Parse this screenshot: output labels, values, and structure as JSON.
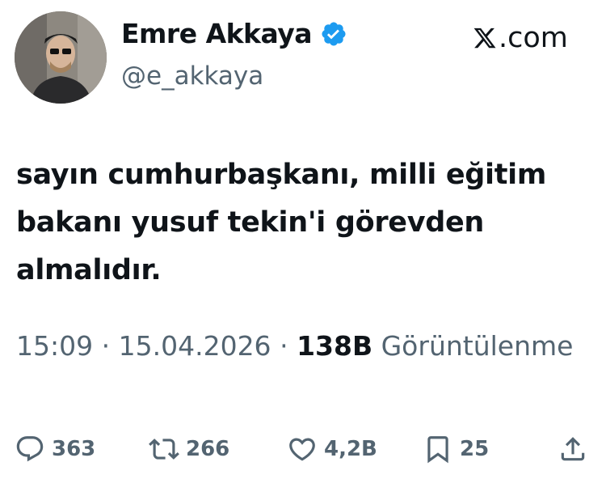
{
  "user": {
    "display_name": "Emre Akkaya",
    "handle": "@e_akkaya",
    "verified": true
  },
  "brand": {
    "label": ".com"
  },
  "tweet": {
    "text": "sayın cumhurbaşkanı, milli eğitim\nbakanı yusuf tekin'i görevden\nalmalıdır."
  },
  "meta": {
    "time": "15:09",
    "date": "15.04.2026",
    "views_count": "138B",
    "views_label": "Görüntülenme",
    "sep": "·"
  },
  "actions": {
    "replies": "363",
    "reposts": "266",
    "likes": "4,2B",
    "bookmarks": "25"
  },
  "colors": {
    "text": "#0f1419",
    "secondary": "#536471",
    "verified": "#1d9bf0"
  }
}
